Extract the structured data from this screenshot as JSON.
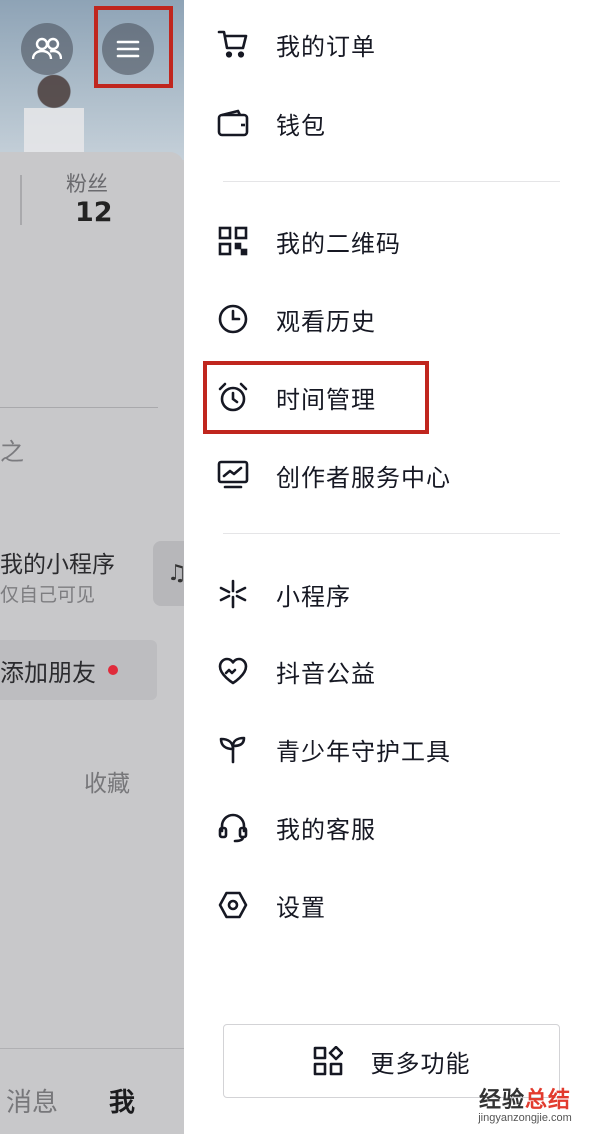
{
  "background_profile": {
    "fans_label": "粉丝",
    "fans_count": "12",
    "fragment_text": "之",
    "mini_program_title": "我的小程序",
    "mini_program_subtitle": "仅自己可见",
    "add_friend_label": "添加朋友",
    "favorites_tab": "收藏",
    "bottom_tabs": {
      "messages": "消息",
      "me": "我"
    }
  },
  "drawer": {
    "items": [
      {
        "label": "我的订单",
        "icon": "cart-icon"
      },
      {
        "label": "钱包",
        "icon": "wallet-icon"
      },
      {
        "label": "我的二维码",
        "icon": "qr-code-icon"
      },
      {
        "label": "观看历史",
        "icon": "clock-icon"
      },
      {
        "label": "时间管理",
        "icon": "alarm-clock-icon"
      },
      {
        "label": "创作者服务中心",
        "icon": "monitor-chart-icon"
      },
      {
        "label": "小程序",
        "icon": "mini-program-icon"
      },
      {
        "label": "抖音公益",
        "icon": "charity-heart-icon"
      },
      {
        "label": "青少年守护工具",
        "icon": "sprout-icon"
      },
      {
        "label": "我的客服",
        "icon": "headset-icon"
      },
      {
        "label": "设置",
        "icon": "hexagon-settings-icon"
      }
    ],
    "more_button_label": "更多功能"
  },
  "watermark": {
    "accent": "经验",
    "main": "总结",
    "sub": "jingyanzongjie.com"
  },
  "colors": {
    "highlight": "#c0261e",
    "text": "#161823",
    "badge": "#e02b3b"
  }
}
